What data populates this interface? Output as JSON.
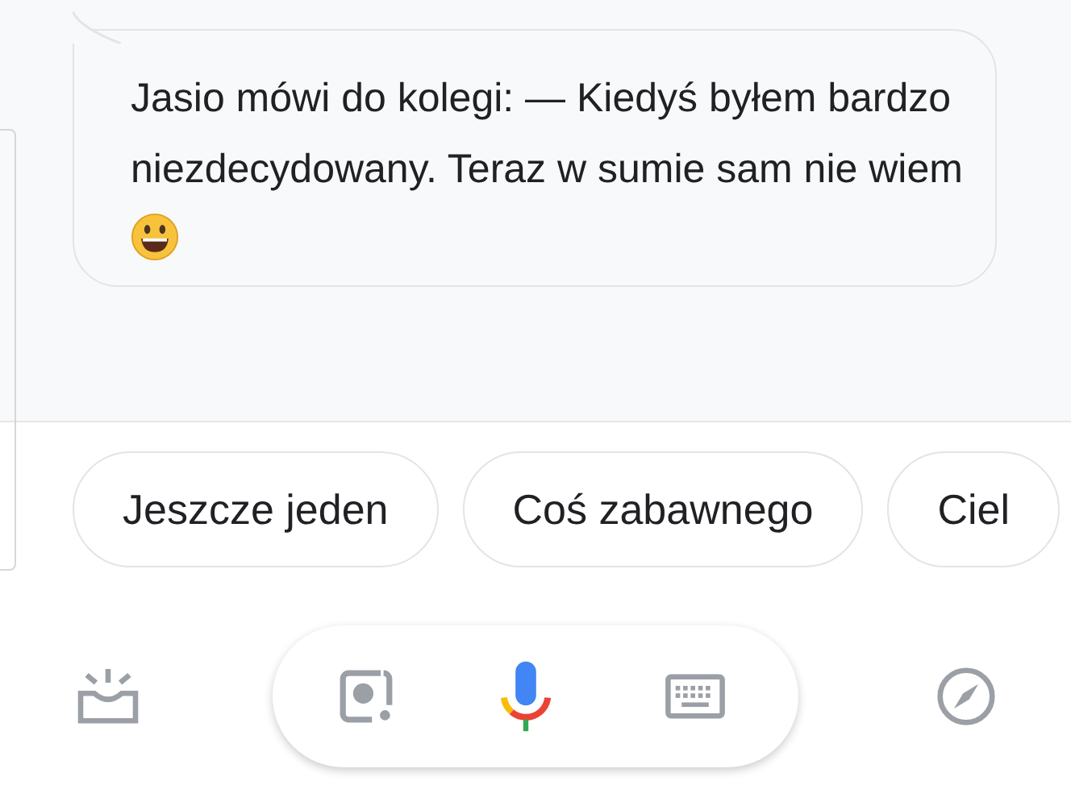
{
  "message": {
    "text": "Jasio mówi do kolegi: — Kiedyś byłem bardzo niezdecydowany. Teraz w sumie sam nie wiem"
  },
  "suggestions": [
    {
      "label": "Jeszcze jeden"
    },
    {
      "label": "Coś zabawnego"
    },
    {
      "label": "Ciel"
    }
  ]
}
